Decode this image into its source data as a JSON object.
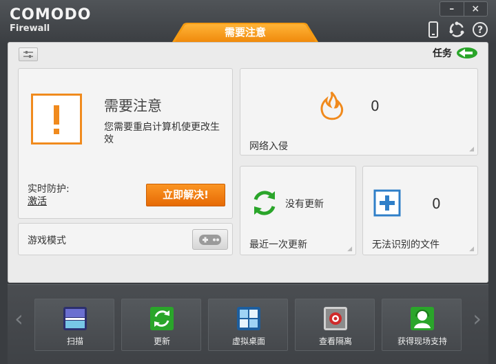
{
  "app": {
    "brand": "COMODO",
    "subtitle": "Firewall"
  },
  "window": {
    "minimize": "–",
    "close": "×"
  },
  "status_tab": "需要注意",
  "toolbar": {
    "tasks_label": "任务"
  },
  "alert": {
    "title": "需要注意",
    "description": "您需要重启计算机使更改生效",
    "realtime_label": "实时防护:",
    "realtime_value": "激活",
    "fix_button": "立即解决!"
  },
  "game_mode": {
    "label": "游戏模式"
  },
  "intrusion": {
    "count": "0",
    "label": "网络入侵"
  },
  "update": {
    "status": "没有更新",
    "label": "最近一次更新"
  },
  "unrecognized": {
    "count": "0",
    "label": "无法识别的文件"
  },
  "tiles": [
    {
      "label": "扫描",
      "icon": "scan-icon"
    },
    {
      "label": "更新",
      "icon": "update-icon"
    },
    {
      "label": "虚拟桌面",
      "icon": "virtual-desktop-icon"
    },
    {
      "label": "查看隔离",
      "icon": "quarantine-icon"
    },
    {
      "label": "获得现场支持",
      "icon": "live-support-icon"
    }
  ],
  "colors": {
    "accent": "#f08a1d",
    "green": "#2aa52a",
    "blue": "#2f7fc8"
  }
}
